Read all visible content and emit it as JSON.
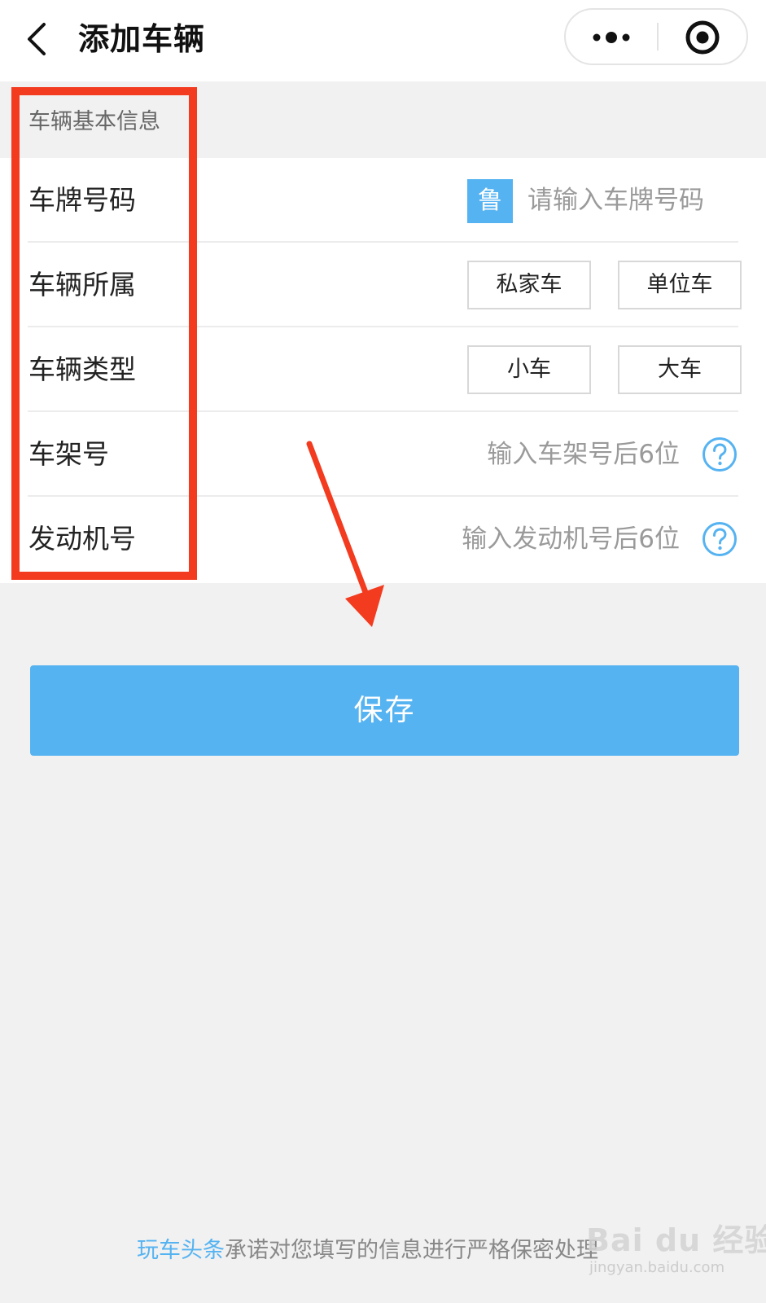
{
  "header": {
    "title": "添加车辆",
    "back_icon": "chevron-left-icon",
    "more_icon": "more-dots-icon",
    "close_icon": "target-circle-icon"
  },
  "form": {
    "section_title": "车辆基本信息",
    "plate": {
      "label": "车牌号码",
      "province": "鲁",
      "placeholder": "请输入车牌号码"
    },
    "ownership": {
      "label": "车辆所属",
      "options": [
        "私家车",
        "单位车"
      ]
    },
    "vehicle_type": {
      "label": "车辆类型",
      "options": [
        "小车",
        "大车"
      ]
    },
    "vin": {
      "label": "车架号",
      "placeholder": "输入车架号后6位",
      "help_icon": "question-circle-icon"
    },
    "engine": {
      "label": "发动机号",
      "placeholder": "输入发动机号后6位",
      "help_icon": "question-circle-icon"
    }
  },
  "save_label": "保存",
  "footer": {
    "brand": "玩车头条",
    "text": "承诺对您填写的信息进行严格保密处理"
  },
  "watermark": {
    "text": "Bai du 经验",
    "sub": "jingyan.baidu.com"
  },
  "colors": {
    "accent": "#56b3f1",
    "annotation": "#f23b1f"
  }
}
